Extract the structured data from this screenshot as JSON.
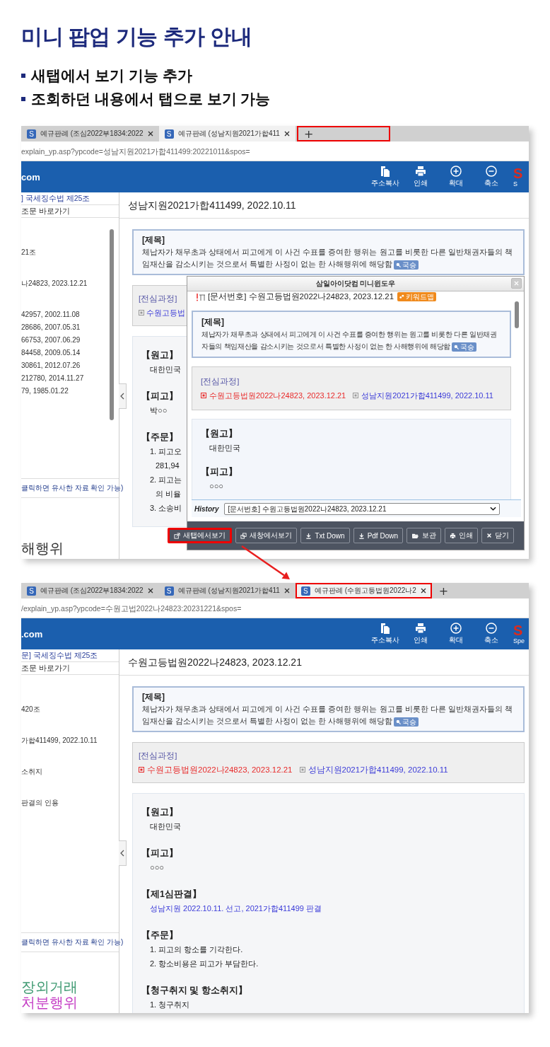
{
  "title": "미니 팝업 기능 추가 안내",
  "bullets": [
    "새탭에서 보기 기능 추가",
    "조회하던 내용에서 탭으로 보기 가능"
  ],
  "shots": [
    {
      "tabs": [
        {
          "icon": "S",
          "label": "예규판례 (조심2022부1834:2022",
          "selected": false,
          "highlighted": false
        },
        {
          "icon": "S",
          "label": "예규판례 (성남지원2021가합411",
          "selected": true,
          "highlighted": false
        }
      ],
      "new_tab": {
        "label": "+",
        "highlighted": true
      },
      "url": "explain_yp.asp?ypcode=성남지원2021가합411499:20221011&spos=",
      "site": "com",
      "toolbar": [
        {
          "kind": "copy",
          "label": "주소복사"
        },
        {
          "kind": "print",
          "label": "인쇄"
        },
        {
          "kind": "zoom_in",
          "label": "확대"
        },
        {
          "kind": "zoom_out",
          "label": "축소"
        }
      ],
      "brand": {
        "mark": "S",
        "caption": "S"
      },
      "sidebar": {
        "links": [
          "] 국세징수법 제25조",
          "조문 바로가기"
        ],
        "scrollable": true,
        "groups": [
          [
            "21조"
          ],
          [
            "나24823, 2023.12.21"
          ],
          [
            "42957, 2002.11.08",
            "28686, 2007.05.31",
            "66753, 2007.06.29",
            "84458, 2009.05.14",
            "30861, 2012.07.26",
            "212780, 2014.11.27",
            "79, 1985.01.22"
          ]
        ],
        "hint": "클릭하면 유사한 자료 확인 가능)",
        "words": [
          {
            "text": "해행위",
            "color": "#333333"
          }
        ]
      },
      "doc": {
        "title": "성남지원2021가합411499, 2022.10.11",
        "subject": {
          "heading": "[제목]",
          "text": "체납자가 채무초과 상태에서 피고에게 이 사건 수표를 증여한 행위는 원고를 비롯한 다른 일반채권자들의 책임재산을 감소시키는 것으로서 특별한 사정이 없는 한 사해행위에 해당함",
          "badge": "국승"
        },
        "history": {
          "heading": "[전심과정]",
          "items": [
            {
              "text": "수원고등법",
              "kind": "link"
            }
          ]
        },
        "sections": [
          {
            "heading": "【원고】",
            "lines": [
              {
                "text": "대한민국",
                "kind": "plain"
              }
            ]
          },
          {
            "heading": "【피고】",
            "lines": [
              {
                "text": "박○○",
                "kind": "plain"
              }
            ]
          },
          {
            "heading": "【주문】",
            "lines": [
              {
                "text": "1. 피고오",
                "kind": "item"
              },
              {
                "text": "281,94",
                "kind": "cont"
              },
              {
                "text": "2. 피고는",
                "kind": "item"
              },
              {
                "text": "의 비율",
                "kind": "cont"
              },
              {
                "text": "3. 소송비",
                "kind": "item"
              }
            ]
          }
        ]
      },
      "popup": {
        "title": "삼일아이닷컴 미니윈도우",
        "doc_number": "[문서번호] 수원고등법원2022나24823, 2023.12.21",
        "keyword_badge": "키워드맵",
        "subject": {
          "heading": "[제목]",
          "text": "체납자가 채무초과 상태에서 피고에게 이 사건 수표를 증여한 행위는 원고를 비롯한 다른 일반채권자들의 책임재산을 감소시키는 것으로서 특별한 사정이 없는 한 사해행위에 해당함",
          "badge": "국승"
        },
        "history": {
          "heading": "[전심과정]",
          "items": [
            {
              "text": "수원고등법원2022나24823, 2023.12.21",
              "kind": "current"
            },
            {
              "text": "성남지원2021가합411499, 2022.10.11",
              "kind": "link"
            }
          ]
        },
        "sections": [
          {
            "heading": "【원고】",
            "lines": [
              {
                "text": "대한민국",
                "kind": "plain"
              }
            ]
          },
          {
            "heading": "【피고】",
            "lines": [
              {
                "text": "○○○",
                "kind": "plain"
              }
            ]
          }
        ],
        "history_label": "History",
        "history_value": "[문서번호] 수원고등법원2022나24823, 2023.12.21",
        "buttons": [
          {
            "kind": "new_tab",
            "label": "새탭에서보기",
            "highlighted": true
          },
          {
            "kind": "new_window",
            "label": "새창에서보기",
            "highlighted": false
          },
          {
            "kind": "download",
            "label": "Txt Down",
            "highlighted": false
          },
          {
            "kind": "download",
            "label": "Pdf Down",
            "highlighted": false
          },
          {
            "kind": "folder",
            "label": "보관",
            "highlighted": false
          },
          {
            "kind": "print",
            "label": "인쇄",
            "highlighted": false
          },
          {
            "kind": "close",
            "label": "닫기",
            "highlighted": false
          }
        ]
      }
    },
    {
      "tabs": [
        {
          "icon": "S",
          "label": "예규판례 (조심2022부1834:2022",
          "selected": false,
          "highlighted": false
        },
        {
          "icon": "S",
          "label": "예규판례 (성남지원2021가합411",
          "selected": false,
          "highlighted": false
        },
        {
          "icon": "S",
          "label": "예규판례 (수원고등법원2022나2",
          "selected": true,
          "highlighted": true
        }
      ],
      "new_tab": {
        "label": "+",
        "highlighted": false
      },
      "url": "/explain_yp.asp?ypcode=수원고법2022나24823:20231221&spos=",
      "site": ".com",
      "toolbar": [
        {
          "kind": "copy",
          "label": "주소복사"
        },
        {
          "kind": "print",
          "label": "인쇄"
        },
        {
          "kind": "zoom_in",
          "label": "확대"
        },
        {
          "kind": "zoom_out",
          "label": "축소"
        }
      ],
      "brand": {
        "mark": "S",
        "caption": "Spe"
      },
      "sidebar": {
        "links": [
          "문] 국세징수법 제25조",
          "조문 바로가기"
        ],
        "groups": [
          [
            "420조"
          ],
          [
            "가합411499, 2022.10.11"
          ],
          [
            "소취지"
          ],
          [
            "판결의 인용"
          ]
        ],
        "hint": "클릭하면 유사한 자료 확인 가능)",
        "words": [
          {
            "text": "장외거래",
            "color": "#3f9a72"
          },
          {
            "text": "처분행위",
            "color": "#c43cc4"
          }
        ]
      },
      "doc": {
        "title": "수원고등법원2022나24823, 2023.12.21",
        "subject": {
          "heading": "[제목]",
          "text": "체납자가 채무초과 상태에서 피고에게 이 사건 수표를 증여한 행위는 원고를 비롯한 다른 일반채권자들의 책임재산을 감소시키는 것으로서 특별한 사정이 없는 한 사해행위에 해당함",
          "badge": "국승"
        },
        "history": {
          "heading": "[전심과정]",
          "items": [
            {
              "text": "수원고등법원2022나24823, 2023.12.21",
              "kind": "current"
            },
            {
              "text": "성남지원2021가합411499, 2022.10.11",
              "kind": "link"
            }
          ]
        },
        "sections": [
          {
            "heading": "【원고】",
            "lines": [
              {
                "text": "대한민국",
                "kind": "plain"
              }
            ]
          },
          {
            "heading": "【피고】",
            "lines": [
              {
                "text": "○○○",
                "kind": "plain"
              }
            ]
          },
          {
            "heading": "【제1심판결】",
            "lines": [
              {
                "text": "성남지원 2022.10.11. 선고, 2021가합411499 판결",
                "kind": "link"
              }
            ]
          },
          {
            "heading": "【주문】",
            "lines": [
              {
                "text": "1. 피고의 항소를 기각한다.",
                "kind": "item"
              },
              {
                "text": "2. 항소비용은 피고가 부담한다.",
                "kind": "item"
              }
            ]
          },
          {
            "heading": "【청구취지 및 항소취지】",
            "lines": [
              {
                "text": "1. 청구취지",
                "kind": "item"
              }
            ]
          }
        ]
      }
    }
  ]
}
